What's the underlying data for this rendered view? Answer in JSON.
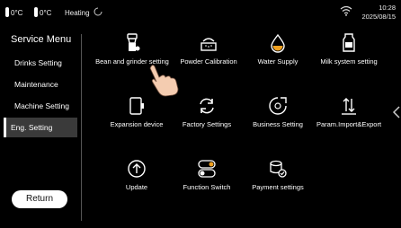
{
  "status": {
    "temp1": "0°C",
    "temp2": "0°C",
    "heating": "Heating",
    "time": "10:28",
    "date": "2025/08/15"
  },
  "sidebar": {
    "title": "Service Menu",
    "items": [
      {
        "label": "Drinks Setting"
      },
      {
        "label": "Maintenance"
      },
      {
        "label": "Machine Setting"
      },
      {
        "label": "Eng. Setting"
      }
    ],
    "return_label": "Return"
  },
  "grid": [
    {
      "label": "Bean and grinder setting",
      "icon": "grinder-icon"
    },
    {
      "label": "Powder Calibration",
      "icon": "powder-icon"
    },
    {
      "label": "Water Supply",
      "icon": "water-drop-icon"
    },
    {
      "label": "Milk system setting",
      "icon": "milk-icon"
    },
    {
      "label": "Expansion device",
      "icon": "device-icon"
    },
    {
      "label": "Factory Settings",
      "icon": "refresh-icon"
    },
    {
      "label": "Business Setting",
      "icon": "business-icon"
    },
    {
      "label": "Param.Import&Export",
      "icon": "import-export-icon"
    },
    {
      "label": "Update",
      "icon": "update-icon"
    },
    {
      "label": "Function Switch",
      "icon": "toggle-icon"
    },
    {
      "label": "Payment settings",
      "icon": "payment-icon"
    }
  ]
}
